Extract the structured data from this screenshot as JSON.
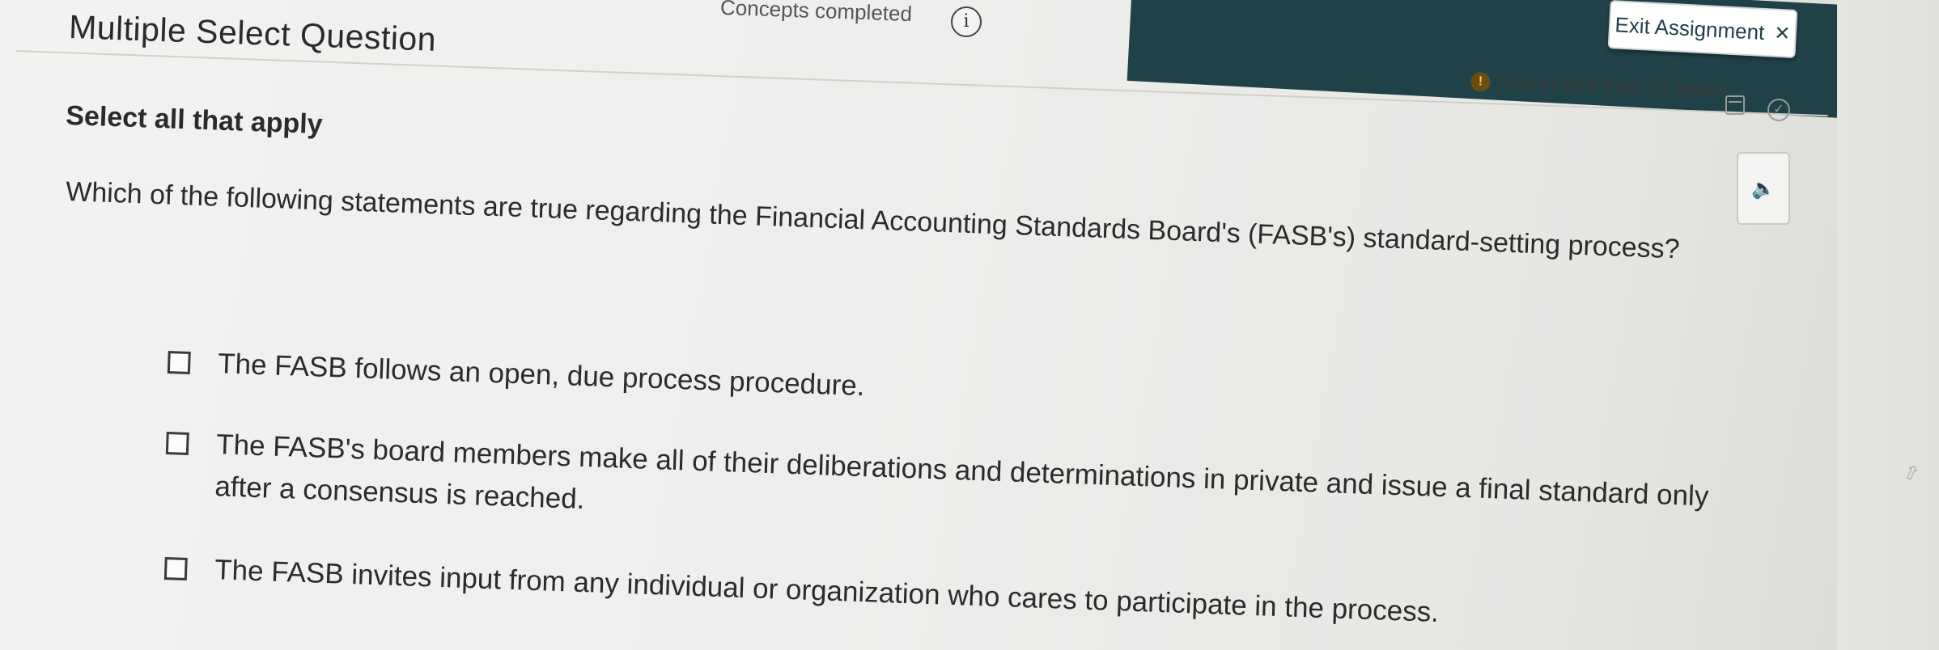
{
  "header": {
    "progress_text": "Concepts completed",
    "exit_label": "Exit Assignment",
    "due_text": "Due in less than 12 hours"
  },
  "question": {
    "type_title": "Multiple Select Question",
    "instruction": "Select all that apply",
    "prompt": "Which of the following statements are true regarding the Financial Accounting Standards Board's (FASB's) standard-setting process?",
    "options": [
      {
        "label": "The FASB follows an open, due process procedure.",
        "checked": false
      },
      {
        "label": "The FASB's board members make all of their deliberations and determinations in private and issue a final standard only after a consensus is reached.",
        "checked": false
      },
      {
        "label": "The FASB invites input from any individual or organization who cares to participate in the process.",
        "checked": false
      }
    ]
  },
  "icons": {
    "info": "info-icon",
    "close": "close-icon",
    "alert": "alert-icon",
    "calendar": "calendar-icon",
    "check": "check-circle-icon",
    "audio": "speaker-icon"
  },
  "colors": {
    "header_band": "#1f4248",
    "alert": "#6b4d0f",
    "text": "#2b2b2b"
  }
}
